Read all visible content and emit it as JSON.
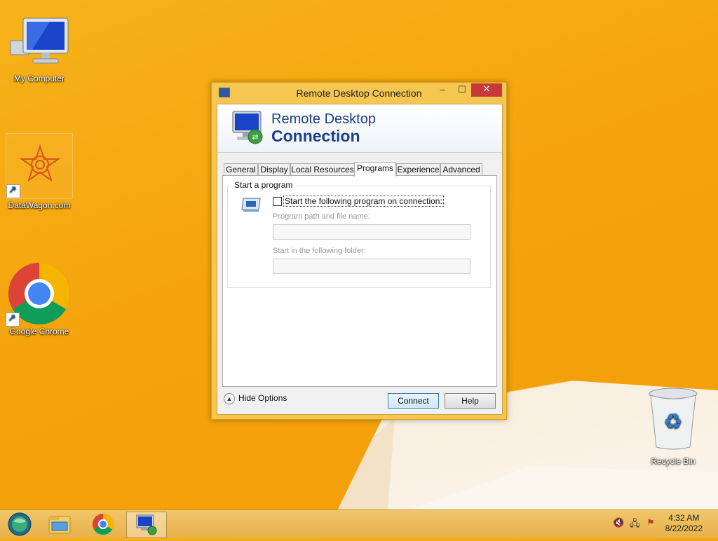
{
  "desktop": {
    "icons": [
      {
        "label": "My Computer"
      },
      {
        "label": "DataWagon.com"
      },
      {
        "label": "Google Chrome"
      },
      {
        "label": "Recycle Bin"
      }
    ]
  },
  "window": {
    "title": "Remote Desktop Connection",
    "banner_line1": "Remote Desktop",
    "banner_line2": "Connection",
    "controls": {
      "minimize": "–",
      "maximize": "☐",
      "close": "✕"
    },
    "tabs": [
      "General",
      "Display",
      "Local Resources",
      "Programs",
      "Experience",
      "Advanced"
    ],
    "active_tab": "Programs",
    "programs": {
      "group_label": "Start a program",
      "checkbox_label": "Start the following program on connection:",
      "checkbox_checked": false,
      "path_label": "Program path and file name:",
      "path_value": "",
      "folder_label": "Start in the following folder:",
      "folder_value": ""
    },
    "hide_options": "Hide Options",
    "connect": "Connect",
    "help": "Help"
  },
  "taskbar": {
    "items": [
      "start-orb-icon",
      "file-explorer-icon",
      "chrome-icon",
      "remote-desktop-icon"
    ],
    "active_item": "remote-desktop-icon",
    "time": "4:32 AM",
    "date": "8/22/2022"
  }
}
